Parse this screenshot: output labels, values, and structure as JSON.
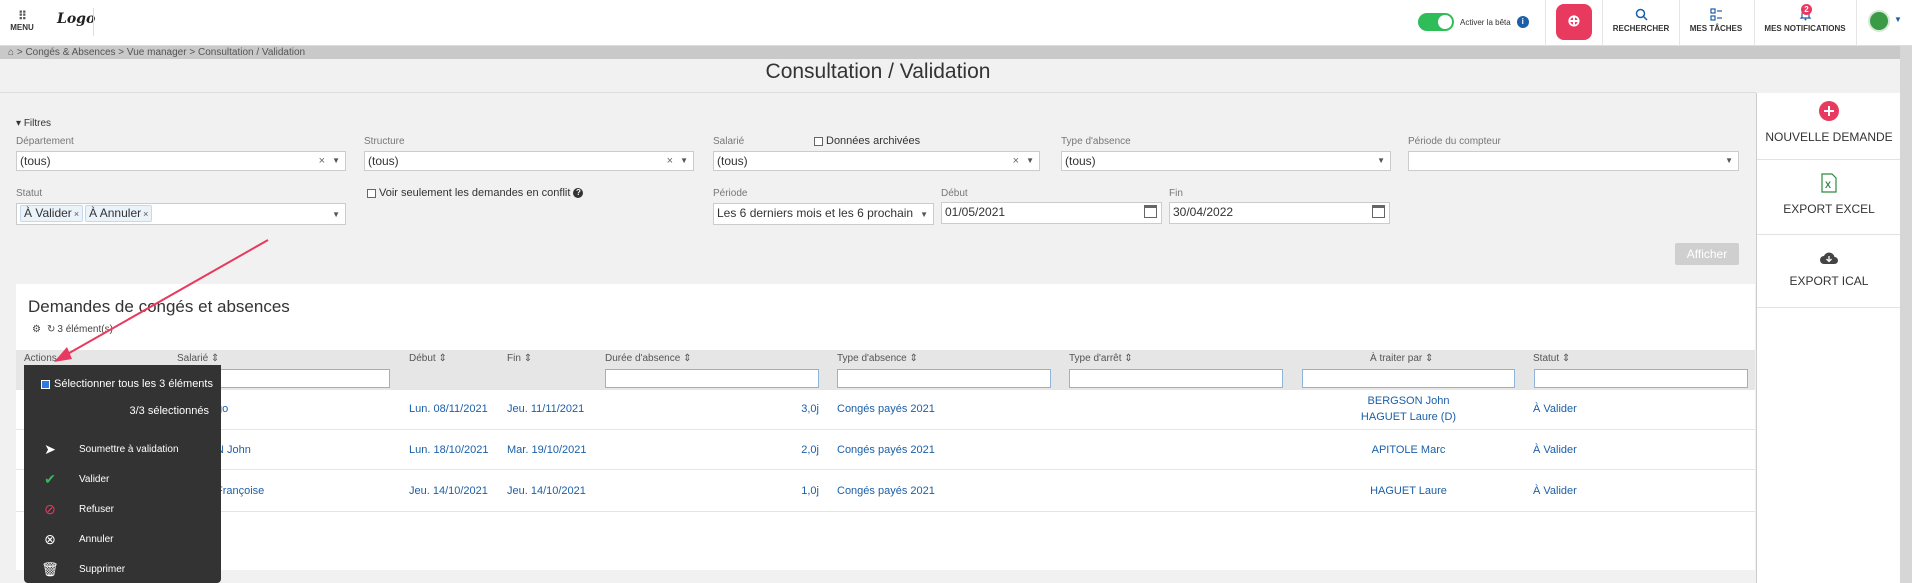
{
  "topbar": {
    "menu_label": "MENU",
    "logo_text": "Logo",
    "beta_label": "Activer la bêta",
    "search_label": "RECHERCHER",
    "tasks_label": "MES TÂCHES",
    "notifications_label": "MES NOTIFICATIONS",
    "notifications_count": "2"
  },
  "breadcrumb": "Congés & Absences > Vue manager > Consultation / Validation",
  "page_title": "Consultation / Validation",
  "right_panel": {
    "new_request": "NOUVELLE DEMANDE",
    "export_excel": "EXPORT EXCEL",
    "export_ical": "EXPORT ICAL"
  },
  "filters": {
    "toggle_label": "Filtres",
    "departement_label": "Département",
    "departement_value": "(tous)",
    "structure_label": "Structure",
    "structure_value": "(tous)",
    "salarie_label": "Salarié",
    "salarie_value": "(tous)",
    "archived_label": "Données archivées",
    "type_label": "Type d'absence",
    "type_value": "(tous)",
    "periode_compteur_label": "Période du compteur",
    "periode_compteur_value": "",
    "statut_label": "Statut",
    "statut_chips": [
      "À Valider",
      "À Annuler"
    ],
    "conflict_label": "Voir seulement les demandes en conflit",
    "periode_label": "Période",
    "periode_value": "Les 6 derniers mois et les 6 prochains",
    "debut_label": "Début",
    "debut_value": "01/05/2021",
    "fin_label": "Fin",
    "fin_value": "30/04/2022",
    "afficher_label": "Afficher"
  },
  "results": {
    "title": "Demandes de congés et absences",
    "count": "3 élément(s)",
    "columns": {
      "actions": "Actions",
      "salarie": "Salarié",
      "debut": "Début",
      "fin": "Fin",
      "duree": "Durée d'absence",
      "type_absence": "Type d'absence",
      "type_arret": "Type d'arrêt",
      "traiter_par": "À traiter par",
      "statut": "Statut"
    },
    "rows": [
      {
        "salarie": "go",
        "debut": "Lun. 08/11/2021",
        "fin": "Jeu. 11/11/2021",
        "duree": "3,0j",
        "type": "Congés payés 2021",
        "arret": "",
        "par1": "BERGSON John",
        "par2": "HAGUET Laure (D)",
        "statut": "À Valider"
      },
      {
        "salarie": "N John",
        "debut": "Lun. 18/10/2021",
        "fin": "Mar. 19/10/2021",
        "duree": "2,0j",
        "type": "Congés payés 2021",
        "arret": "",
        "par1": "APITOLE Marc",
        "par2": "",
        "statut": "À Valider"
      },
      {
        "salarie": "Françoise",
        "debut": "Jeu. 14/10/2021",
        "fin": "Jeu. 14/10/2021",
        "duree": "1,0j",
        "type": "Congés payés 2021",
        "arret": "",
        "par1": "HAGUET Laure",
        "par2": "",
        "statut": "À Valider"
      }
    ]
  },
  "actions_menu": {
    "select_all": "Sélectionner tous les 3 éléments",
    "selected_count": "3/3 sélectionnés",
    "items": [
      "Soumettre à validation",
      "Valider",
      "Refuser",
      "Annuler",
      "Supprimer"
    ]
  },
  "colors": {
    "accent_pink": "#e8395e",
    "link_blue": "#1b5fa8",
    "toggle_green": "#2ebd59"
  }
}
